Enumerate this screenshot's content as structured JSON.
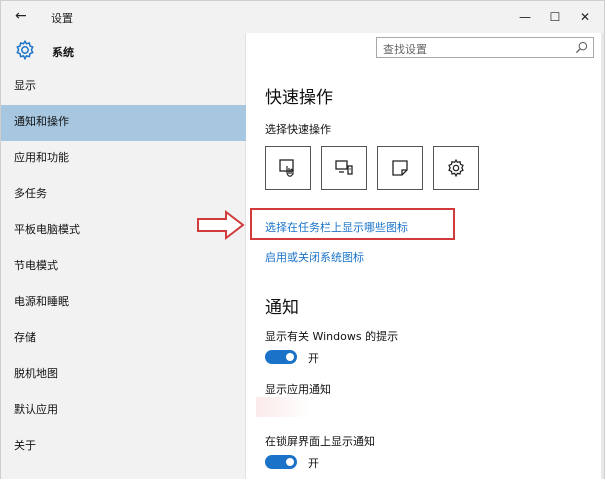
{
  "window": {
    "title": "设置",
    "back_glyph": "←",
    "minimize_glyph": "—",
    "maximize_glyph": "☐",
    "close_glyph": "✕"
  },
  "sidebar": {
    "brand_label": "系统",
    "items": [
      {
        "label": "显示"
      },
      {
        "label": "通知和操作",
        "active": true
      },
      {
        "label": "应用和功能"
      },
      {
        "label": "多任务"
      },
      {
        "label": "平板电脑模式"
      },
      {
        "label": "节电模式"
      },
      {
        "label": "电源和睡眠"
      },
      {
        "label": "存储"
      },
      {
        "label": "脱机地图"
      },
      {
        "label": "默认应用"
      },
      {
        "label": "关于"
      }
    ]
  },
  "search": {
    "placeholder": "查找设置"
  },
  "main": {
    "quick_actions_title": "快速操作",
    "select_quick_actions": "选择快速操作",
    "quick_action_icons": [
      "tablet-touch-icon",
      "connect-icon",
      "note-icon",
      "settings-icon"
    ],
    "link_taskbar_icons": "选择在任务栏上显示哪些图标",
    "link_system_icons": "启用或关闭系统图标",
    "notifications_title": "通知",
    "show_windows_tips": "显示有关 Windows 的提示",
    "toggle1_state": "开",
    "show_app_notifications": "显示应用通知",
    "show_on_lock_screen": "在锁屏界面上显示通知",
    "toggle2_state": "开"
  },
  "colors": {
    "accent": "#1a73c8",
    "sidebar_active": "#a7c7e0",
    "highlight": "#d23b3b"
  }
}
